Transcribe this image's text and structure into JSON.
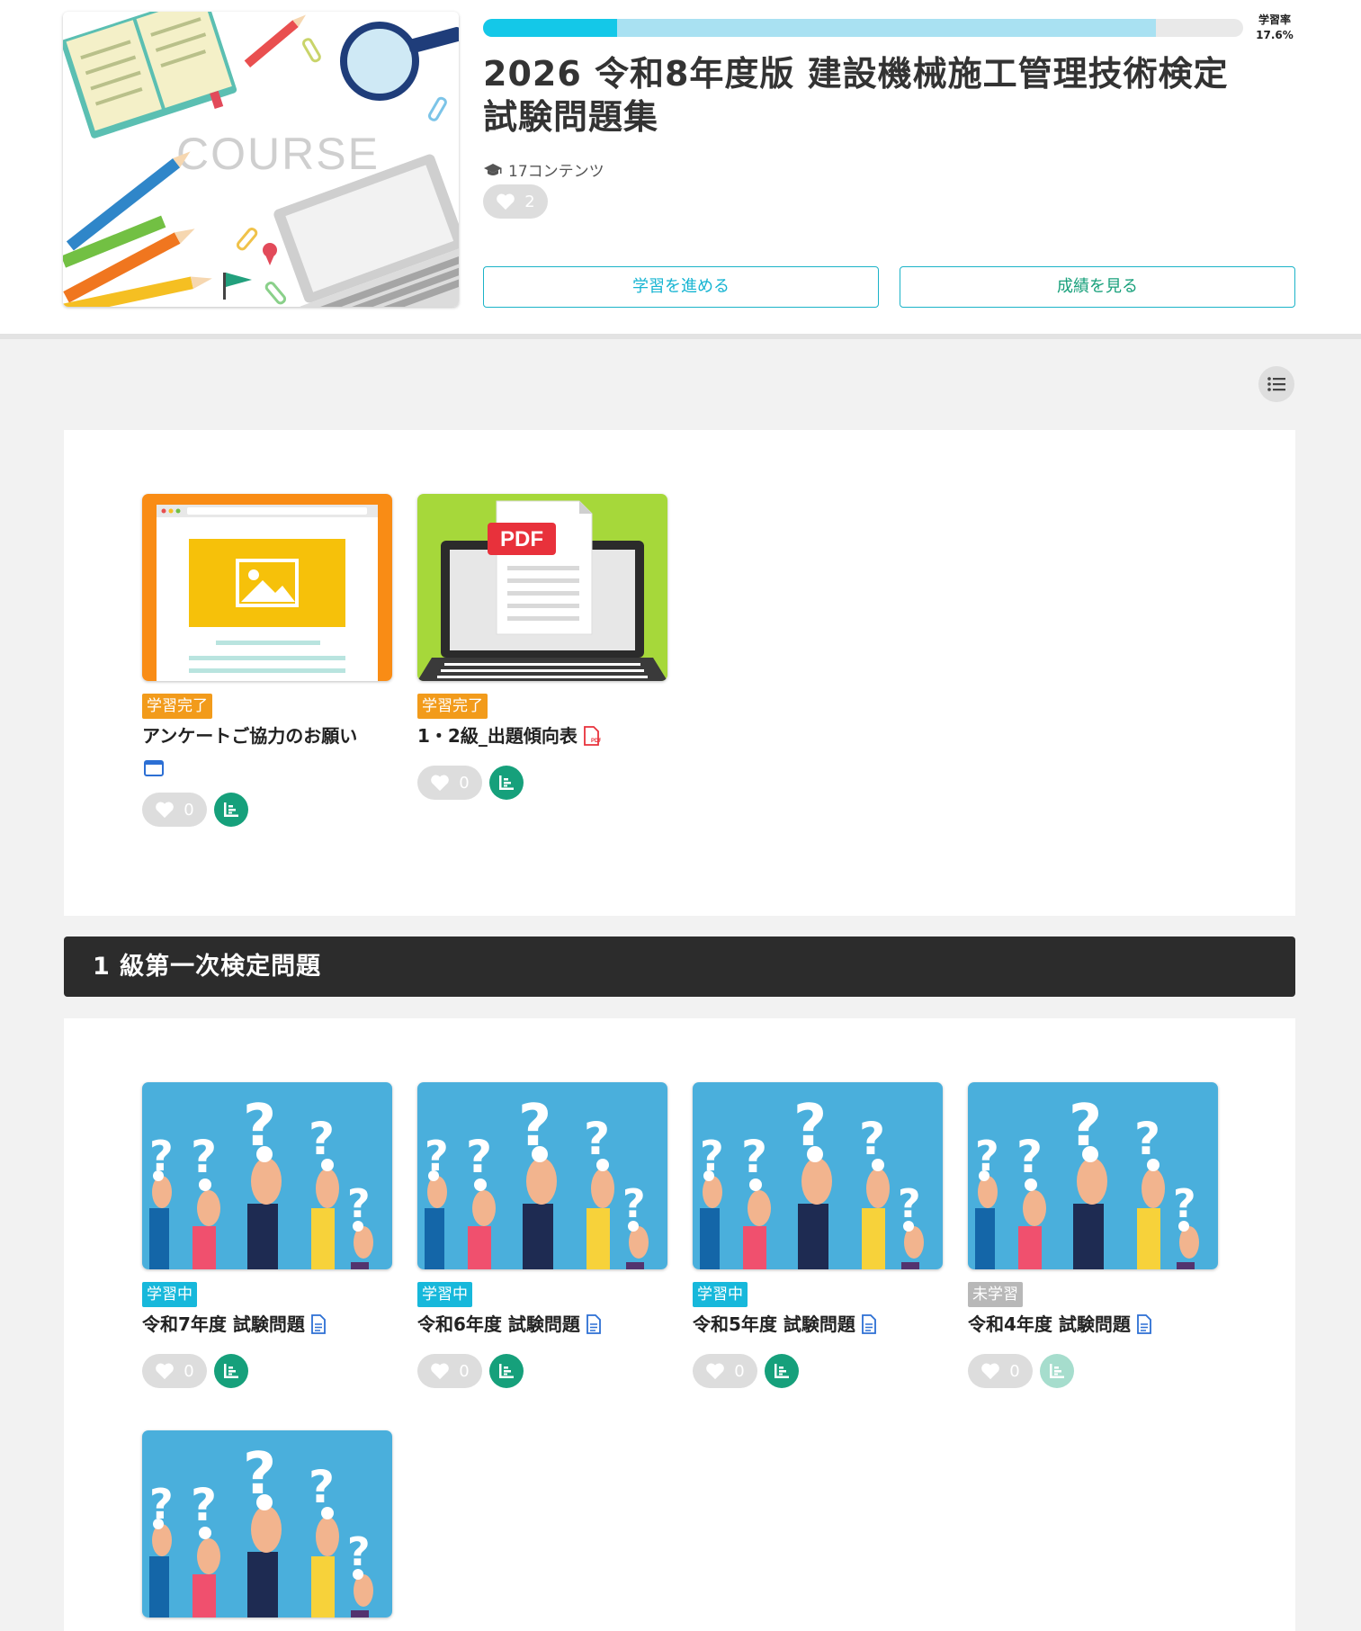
{
  "course": {
    "thumbnail_text": "COURSE",
    "progress": {
      "label": "学習率",
      "value": "17.6%",
      "fraction": 0.176,
      "buffer_fraction": 0.885
    },
    "title": "2026 令和8年度版 建設機械施工管理技術検定 試験問題集",
    "content_count": "17コンテンツ",
    "likes": "2",
    "continue_label": "学習を進める",
    "grades_label": "成績を見る"
  },
  "intro_cards": [
    {
      "status": "学習完了",
      "status_type": "done",
      "title": "アンケートご協力のお願い",
      "type_icon": "browser-icon",
      "likes": "0"
    },
    {
      "status": "学習完了",
      "status_type": "done",
      "title": "1・2級_出題傾向表",
      "type_icon": "pdf-icon",
      "likes": "0",
      "thumbnail_text": "PDF"
    }
  ],
  "sections": [
    {
      "title": "1 級第一次検定問題",
      "cards": [
        {
          "status": "学習中",
          "status_type": "studying",
          "title": "令和7年度 試験問題",
          "type_icon": "document-icon",
          "likes": "0"
        },
        {
          "status": "学習中",
          "status_type": "studying",
          "title": "令和6年度 試験問題",
          "type_icon": "document-icon",
          "likes": "0"
        },
        {
          "status": "学習中",
          "status_type": "studying",
          "title": "令和5年度 試験問題",
          "type_icon": "document-icon",
          "likes": "0"
        },
        {
          "status": "未学習",
          "status_type": "not",
          "title": "令和4年度 試験問題",
          "type_icon": "document-icon",
          "likes": "0"
        },
        {
          "status": "",
          "status_type": "",
          "title": "",
          "type_icon": "",
          "likes": ""
        }
      ]
    }
  ],
  "colors": {
    "accent": "#14c8e8",
    "grade": "#16a07b",
    "done": "#f29b1b",
    "studying": "#17b8db",
    "not_started": "#b8b8b8",
    "section_bar": "#2c2c2c"
  }
}
